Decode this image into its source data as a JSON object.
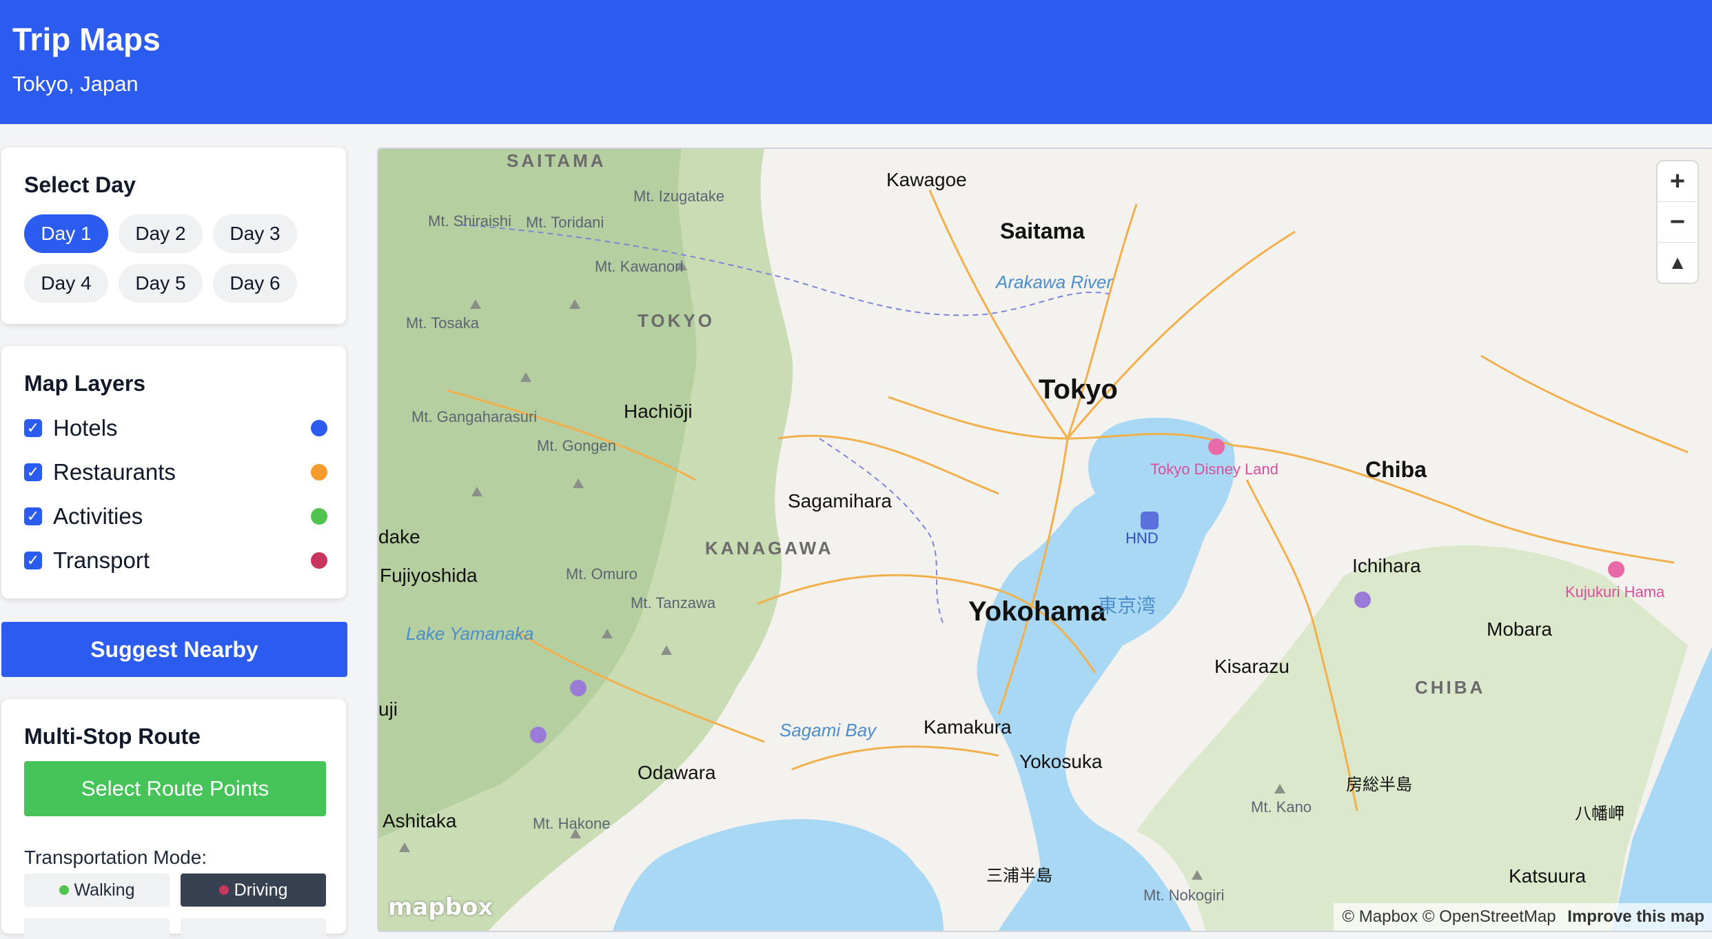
{
  "header": {
    "title": "Trip Maps",
    "subtitle": "Tokyo, Japan"
  },
  "day_select": {
    "title": "Select Day",
    "days": [
      "Day 1",
      "Day 2",
      "Day 3",
      "Day 4",
      "Day 5",
      "Day 6"
    ],
    "active": "Day 1"
  },
  "layers": {
    "title": "Map Layers",
    "items": [
      {
        "label": "Hotels",
        "checked": true,
        "color": "#2c5bf0"
      },
      {
        "label": "Restaurants",
        "checked": true,
        "color": "#f59b2e"
      },
      {
        "label": "Activities",
        "checked": true,
        "color": "#4fc34e"
      },
      {
        "label": "Transport",
        "checked": true,
        "color": "#c7365c"
      }
    ]
  },
  "suggest_label": "Suggest Nearby",
  "route": {
    "title": "Multi-Stop Route",
    "select_label": "Select Route Points",
    "mode_label": "Transportation Mode:",
    "modes": [
      {
        "label": "Walking",
        "color": "#4fc34e",
        "active": false
      },
      {
        "label": "Driving",
        "color": "#c7365c",
        "active": true
      }
    ]
  },
  "map": {
    "labels": {
      "saitama_pref": "SAITAMA",
      "tokyo_pref": "TOKYO",
      "kanagawa_pref": "KANAGAWA",
      "chiba_pref": "CHIBA",
      "kawagoe": "Kawagoe",
      "saitama": "Saitama",
      "tokyo": "Tokyo",
      "hachioji": "Hachiōji",
      "sagamihara": "Sagamihara",
      "yokohama": "Yokohama",
      "chiba": "Chiba",
      "ichihara": "Ichihara",
      "kisarazu": "Kisarazu",
      "mobara": "Mobara",
      "kamakura": "Kamakura",
      "yokosuka": "Yokosuka",
      "odawara": "Odawara",
      "fujiyoshida": "Fujiyoshida",
      "ashitaka": "Ashitaka",
      "katsuura": "Katsuura",
      "tokyo_bay": "東京湾",
      "sagami_bay": "Sagami Bay",
      "arakawa": "Arakawa River",
      "lake": "Lake Yamanaka",
      "disney": "Tokyo Disney Land",
      "kujukuri": "Kujukuri Hama",
      "hnd": "HND",
      "mt_izugatake": "Mt. Izugatake",
      "mt_shiraishi": "Mt. Shiraishi",
      "mt_toridani": "Mt. Toridani",
      "mt_kawanori": "Mt. Kawanori",
      "mt_tosaka": "Mt. Tosaka",
      "mt_gangaharasuri": "Mt. Gangaharasuri",
      "mt_gongen": "Mt. Gongen",
      "mt_omuro": "Mt. Omuro",
      "mt_tanzawa": "Mt. Tanzawa",
      "mt_hakone": "Mt. Hakone",
      "mt_kano": "Mt. Kano",
      "mt_nokogiri": "Mt. Nokogiri",
      "boso": "房総半島",
      "miura": "三浦半島",
      "yawata": "八幡岬",
      "dake": "dake",
      "uji": "uji"
    },
    "attribution": "© Mapbox © OpenStreetMap",
    "improve": "Improve this map",
    "logo": "mapbox"
  }
}
